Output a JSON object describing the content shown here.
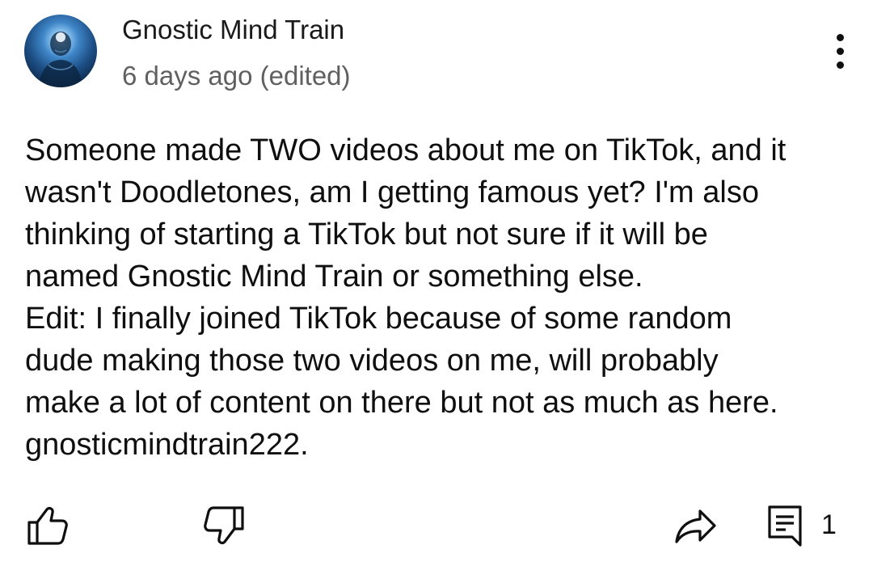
{
  "comment": {
    "author": "Gnostic Mind Train",
    "meta": "6 days ago (edited)",
    "text_lines": [
      "Someone made TWO videos about me on TikTok, and it",
      "wasn't Doodletones, am I getting famous yet? I'm also",
      "thinking of starting a TikTok but not sure if it will be",
      "named Gnostic Mind Train or something else.",
      "Edit: I finally joined TikTok because of some random",
      "dude making those two videos on me, will probably",
      "make a lot of content on there but not as much as here.",
      "gnosticmindtrain222."
    ],
    "reply_count": "1"
  },
  "icons": {
    "avatar": "avatar-meditating-figure",
    "menu": "more-vert-icon",
    "like": "thumbs-up-icon",
    "dislike": "thumbs-down-icon",
    "share": "share-icon",
    "reply": "comment-icon"
  },
  "colors": {
    "text_primary": "#0f0f0f",
    "text_secondary": "#606060",
    "background": "#ffffff"
  }
}
